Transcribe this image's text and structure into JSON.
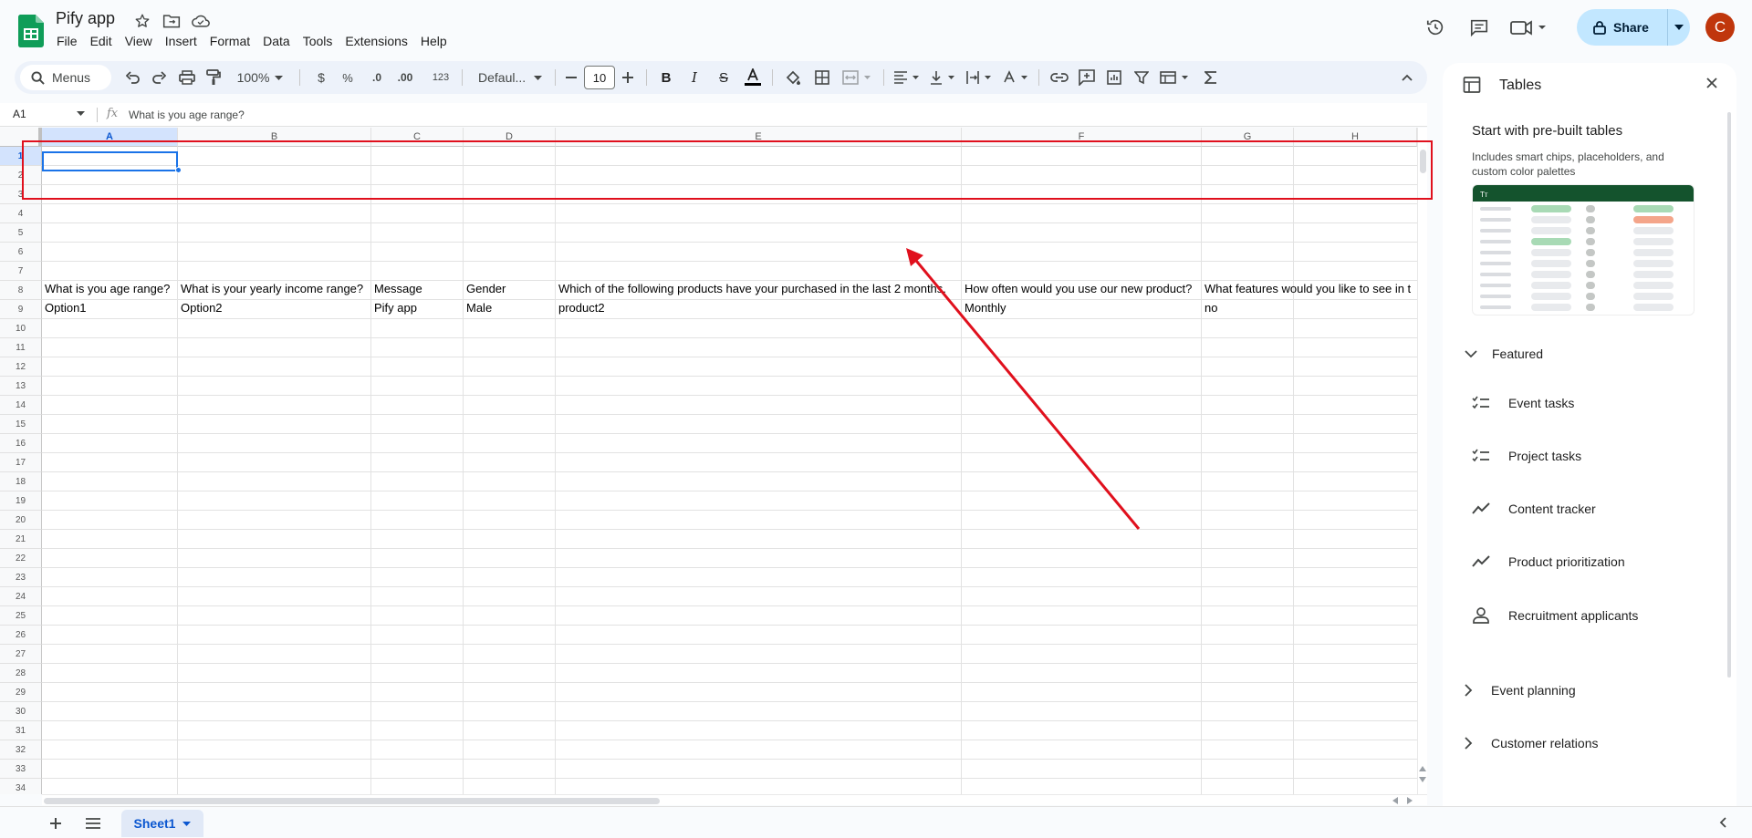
{
  "app": {
    "doc_title": "Pify app",
    "menu": [
      "File",
      "Edit",
      "View",
      "Insert",
      "Format",
      "Data",
      "Tools",
      "Extensions",
      "Help"
    ],
    "share_label": "Share",
    "avatar_letter": "C"
  },
  "toolbar": {
    "search_label": "Menus",
    "zoom": "100%",
    "currency": "$",
    "percent": "%",
    "dec_decrease": ".0",
    "dec_increase": ".00",
    "number_format": "123",
    "font": "Defaul...",
    "font_size": "10"
  },
  "formula_bar": {
    "cell_ref": "A1",
    "fx": "fx",
    "content": "What is you age range?"
  },
  "grid": {
    "columns": [
      "A",
      "B",
      "C",
      "D",
      "E",
      "F",
      "G",
      "H"
    ],
    "row_numbers": [
      "1",
      "2",
      "3",
      "4",
      "5",
      "6",
      "7",
      "8",
      "9",
      "10",
      "11",
      "12",
      "13",
      "14",
      "15",
      "16",
      "17",
      "18",
      "19",
      "20",
      "21",
      "22",
      "23",
      "24",
      "25",
      "26",
      "27",
      "28",
      "29",
      "30",
      "31",
      "32",
      "33",
      "34"
    ],
    "row1": [
      "What is you age range?",
      "What is your yearly income range?",
      "Message",
      "Gender",
      "Which of the following products have your purchased in the last 2 months.",
      "How often would you use our new product?",
      "What features would you like to see in t"
    ],
    "row2": [
      "Option1",
      "Option2",
      "Pify app",
      "Male",
      "product2",
      "Monthly",
      "no"
    ]
  },
  "sheet_tab": "Sheet1",
  "panel": {
    "title": "Tables",
    "heading": "Start with pre-built tables",
    "description": "Includes smart chips, placeholders, and custom color palettes",
    "featured_label": "Featured",
    "templates": [
      "Event tasks",
      "Project tasks",
      "Content tracker",
      "Product prioritization",
      "Recruitment applicants"
    ],
    "sections": [
      "Event planning",
      "Customer relations"
    ],
    "preview_header": "Tт"
  },
  "colors": {
    "accent": "#0b57d0",
    "share_bg": "#c2e7ff",
    "annotation": "#e0101d",
    "avatar": "#c0360c",
    "sheets_green": "#0f9d58"
  }
}
